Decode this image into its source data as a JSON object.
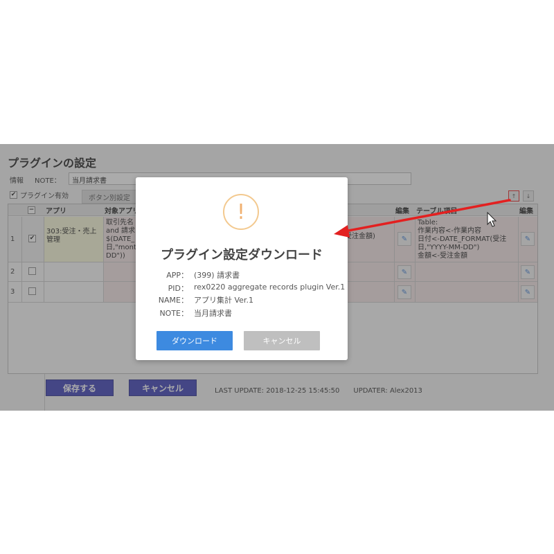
{
  "page": {
    "title": "プラグインの設定",
    "info_label": "情報",
    "note_label": "NOTE：",
    "note_value": "当月請求書",
    "enable_label": "プラグイン有効",
    "enable_checked": "✔",
    "tab_label": "ボタン別設定",
    "sort_up": "↑",
    "sort_down": "↓"
  },
  "table": {
    "headers": {
      "app": "アプリ",
      "target": "対象アプリ",
      "edit1": "編集",
      "table_items": "テーブル項目",
      "edit2": "編集"
    },
    "rows": [
      {
        "num": "1",
        "checked": "✔",
        "app": "303:受注・売上管理",
        "target": "取引先名\nand 請求\n$(DATE_\n日,\"montl\nDD\"))",
        "mid": "受注金額)",
        "table_items": "Table:\n作業内容<-作業内容\n日付<-DATE_FORMAT(受注日,\"YYYY-MM-DD\")\n金額<-受注金額"
      },
      {
        "num": "2",
        "checked": "",
        "app": "",
        "target": "",
        "mid": "",
        "table_items": ""
      },
      {
        "num": "3",
        "checked": "",
        "app": "",
        "target": "",
        "mid": "",
        "table_items": ""
      }
    ]
  },
  "footer": {
    "save": "保存する",
    "cancel": "キャンセル",
    "last_update": "LAST UPDATE: 2018-12-25 15:45:50　　UPDATER: Alex2013"
  },
  "modal": {
    "icon": "!",
    "title": "プラグイン設定ダウンロード",
    "fields": [
      {
        "k": "APP：",
        "v": "(399) 請求書"
      },
      {
        "k": "PID：",
        "v": "rex0220 aggregate records plugin Ver.1"
      },
      {
        "k": "NAME：",
        "v": "アプリ集計 Ver.1"
      },
      {
        "k": "NOTE：",
        "v": "当月請求書"
      }
    ],
    "download": "ダウンロード",
    "cancel": "キャンセル"
  },
  "colors": {
    "accent": "#3d8ae0",
    "save_button": "#3b3fb6",
    "warning": "#f0b070",
    "annotation_arrow": "#e32020"
  },
  "icons": {
    "edit": "✎"
  }
}
